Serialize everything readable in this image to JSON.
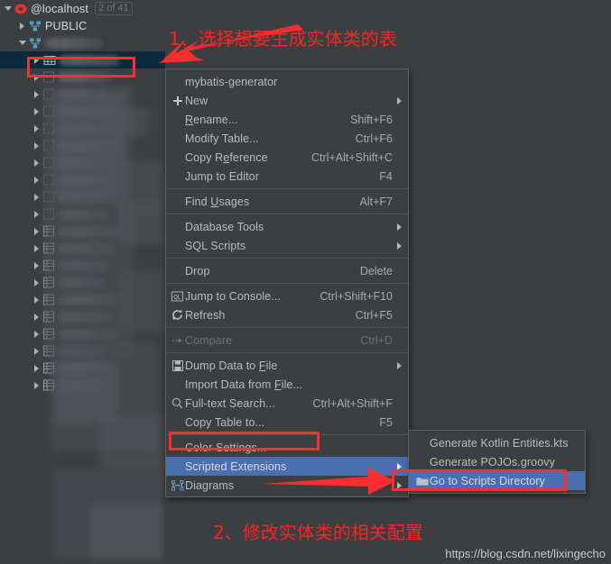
{
  "tree": {
    "rows": [
      {
        "label": "@localhost",
        "badge": "2 of 41",
        "icon": "database-icon",
        "twisty": "open",
        "indent": 0,
        "censored": false
      },
      {
        "label": "PUBLIC",
        "badge": "",
        "icon": "schema-icon",
        "twisty": "closed",
        "indent": 1,
        "censored": false
      },
      {
        "label": "",
        "badge": "",
        "icon": "schema-icon",
        "twisty": "open",
        "indent": 1,
        "censored": true,
        "censor_width": 64
      },
      {
        "label": "",
        "badge": "",
        "icon": "table-icon",
        "twisty": "closed",
        "indent": 2,
        "censored": true,
        "censor_width": 66,
        "selected": true
      }
    ],
    "blurred_row_count": 19
  },
  "annotations": {
    "step1": "1、选择想要生成实体类的表",
    "step2": "2、修改实体类的相关配置",
    "watermark": "https://blog.csdn.net/lixingecho",
    "highlight_color": "#ff2020"
  },
  "context_menu": {
    "items": [
      {
        "label": "mybatis-generator",
        "accel": "",
        "icon": "",
        "arrow": false,
        "type": "item"
      },
      {
        "label": "New",
        "accel": "",
        "icon": "plus-icon",
        "arrow": true,
        "type": "item"
      },
      {
        "label": "Rename...",
        "accel": "Shift+F6",
        "icon": "",
        "arrow": false,
        "type": "item",
        "mnemonic": 0
      },
      {
        "label": "Modify Table...",
        "accel": "Ctrl+F6",
        "icon": "",
        "arrow": false,
        "type": "item"
      },
      {
        "label": "Copy Reference",
        "accel": "Ctrl+Alt+Shift+C",
        "icon": "",
        "arrow": false,
        "type": "item",
        "mnemonic": 6
      },
      {
        "label": "Jump to Editor",
        "accel": "F4",
        "icon": "",
        "arrow": false,
        "type": "item"
      },
      {
        "type": "separator"
      },
      {
        "label": "Find Usages",
        "accel": "Alt+F7",
        "icon": "",
        "arrow": false,
        "type": "item",
        "mnemonic": 5
      },
      {
        "type": "separator"
      },
      {
        "label": "Database Tools",
        "accel": "",
        "icon": "",
        "arrow": true,
        "type": "item"
      },
      {
        "label": "SQL Scripts",
        "accel": "",
        "icon": "",
        "arrow": true,
        "type": "item"
      },
      {
        "type": "separator"
      },
      {
        "label": "Drop",
        "accel": "Delete",
        "icon": "",
        "arrow": false,
        "type": "item"
      },
      {
        "type": "separator"
      },
      {
        "label": "Jump to Console...",
        "accel": "Ctrl+Shift+F10",
        "icon": "console-icon",
        "arrow": false,
        "type": "item"
      },
      {
        "label": "Refresh",
        "accel": "Ctrl+F5",
        "icon": "refresh-icon",
        "arrow": false,
        "type": "item"
      },
      {
        "type": "separator"
      },
      {
        "label": "Compare",
        "accel": "Ctrl+D",
        "icon": "compare-icon",
        "arrow": false,
        "type": "item",
        "disabled": true
      },
      {
        "type": "separator"
      },
      {
        "label": "Dump Data to File",
        "accel": "",
        "icon": "save-icon",
        "arrow": true,
        "type": "item",
        "mnemonic": 13
      },
      {
        "label": "Import Data from File...",
        "accel": "",
        "icon": "",
        "arrow": false,
        "type": "item",
        "mnemonic": 17
      },
      {
        "label": "Full-text Search...",
        "accel": "Ctrl+Alt+Shift+F",
        "icon": "search-icon",
        "arrow": false,
        "type": "item"
      },
      {
        "label": "Copy Table to...",
        "accel": "F5",
        "icon": "",
        "arrow": false,
        "type": "item"
      },
      {
        "type": "separator"
      },
      {
        "label": "Color Settings...",
        "accel": "",
        "icon": "",
        "arrow": false,
        "type": "item"
      },
      {
        "label": "Scripted Extensions",
        "accel": "",
        "icon": "",
        "arrow": true,
        "type": "item",
        "highlighted": true
      },
      {
        "label": "Diagrams",
        "accel": "",
        "icon": "diagram-icon",
        "arrow": true,
        "type": "item"
      }
    ]
  },
  "sub_menu": {
    "items": [
      {
        "label": "Generate Kotlin Entities.kts",
        "icon": "",
        "highlighted": false
      },
      {
        "label": "Generate POJOs.groovy",
        "icon": "",
        "highlighted": false
      },
      {
        "label": "Go to Scripts Directory",
        "icon": "folder-icon",
        "highlighted": true
      }
    ]
  }
}
